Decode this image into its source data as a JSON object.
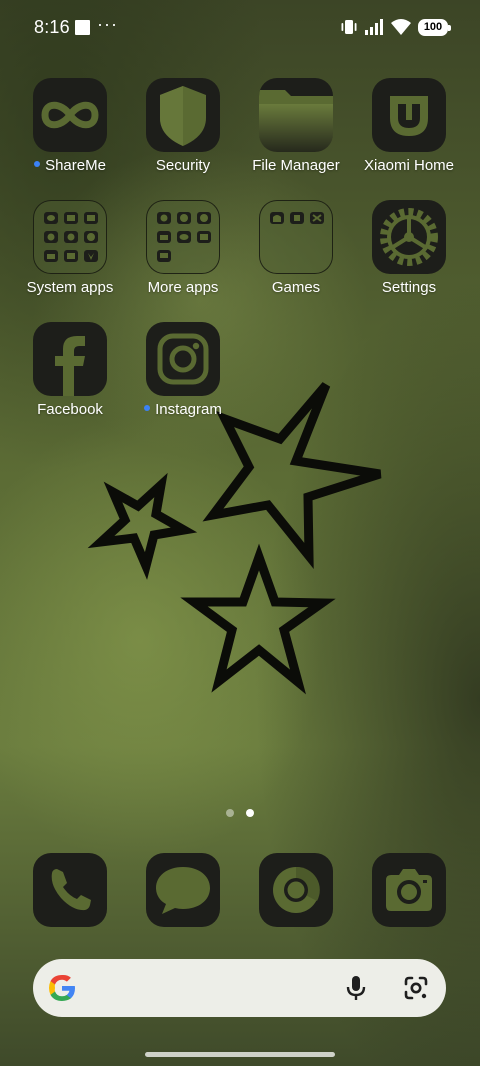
{
  "status_bar": {
    "time": "8:16",
    "more_indicator": "···",
    "battery_level": "100",
    "icons": [
      "notification-square-icon",
      "vibrate-icon",
      "signal-icon",
      "wifi-icon",
      "battery-icon"
    ]
  },
  "apps": {
    "shareme": {
      "label": "ShareMe",
      "new_badge": true,
      "icon": "shareme-icon"
    },
    "security": {
      "label": "Security",
      "icon": "shield-icon"
    },
    "file_manager": {
      "label": "File Manager",
      "icon": "folder-icon"
    },
    "xiaomi_home": {
      "label": "Xiaomi Home",
      "icon": "mi-home-icon"
    },
    "system_apps": {
      "label": "System apps",
      "icon": "folder-icon"
    },
    "more_apps": {
      "label": "More apps",
      "icon": "folder-icon"
    },
    "games": {
      "label": "Games",
      "icon": "folder-icon"
    },
    "settings": {
      "label": "Settings",
      "icon": "gear-icon"
    },
    "facebook": {
      "label": "Facebook",
      "icon": "facebook-icon"
    },
    "instagram": {
      "label": "Instagram",
      "new_badge": true,
      "icon": "instagram-icon"
    }
  },
  "page_indicator": {
    "pages": 2,
    "active_page": 2
  },
  "dock": [
    "phone-icon",
    "messages-icon",
    "browser-icon",
    "camera-icon"
  ],
  "colors": {
    "icon_background": "#1d1e1a",
    "icon_glyph": "#5a6a32",
    "new_badge": "#3b82f6",
    "search_bar": "#edeee8"
  }
}
